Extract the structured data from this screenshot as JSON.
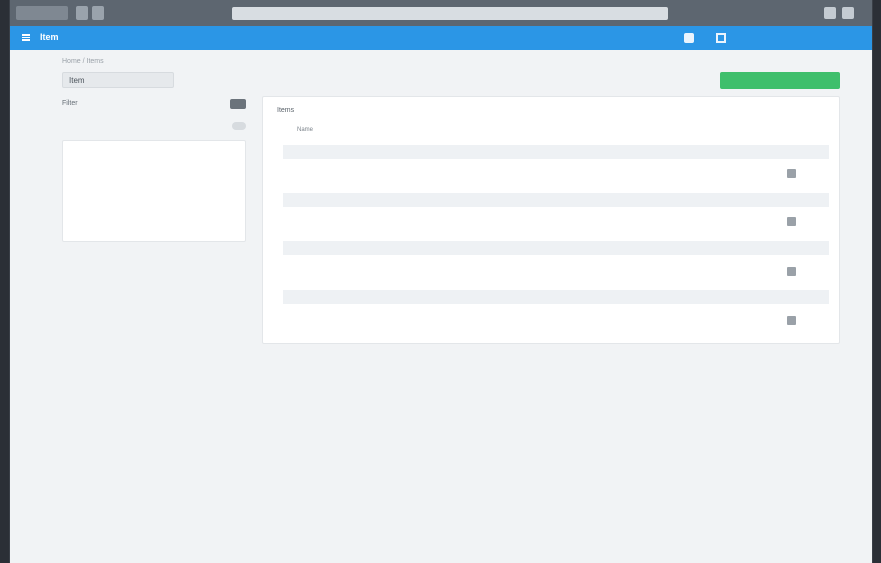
{
  "browser": {
    "tab_label": "",
    "url": ""
  },
  "appbar": {
    "brand": "Item",
    "user": [
      "",
      ""
    ]
  },
  "breadcrumb": "Home / Items",
  "page_title": "Item",
  "add_button": "",
  "filter": {
    "label": "Filter",
    "row_label": ""
  },
  "info_card": {
    "title": "",
    "body": ""
  },
  "main": {
    "title": "Items",
    "headers": [
      "Name",
      "",
      ""
    ],
    "groups": [
      {
        "title": "",
        "item": {
          "name": "",
          "sub": "",
          "date": "",
          "extra": ""
        }
      },
      {
        "title": "",
        "item": {
          "name": "",
          "sub": "",
          "date": "",
          "extra": ""
        }
      },
      {
        "title": "",
        "item": {
          "name": "",
          "sub": "",
          "date": "",
          "extra": ""
        }
      },
      {
        "title": "",
        "item": {
          "name": "",
          "sub": "",
          "date": "",
          "extra": ""
        }
      }
    ]
  }
}
